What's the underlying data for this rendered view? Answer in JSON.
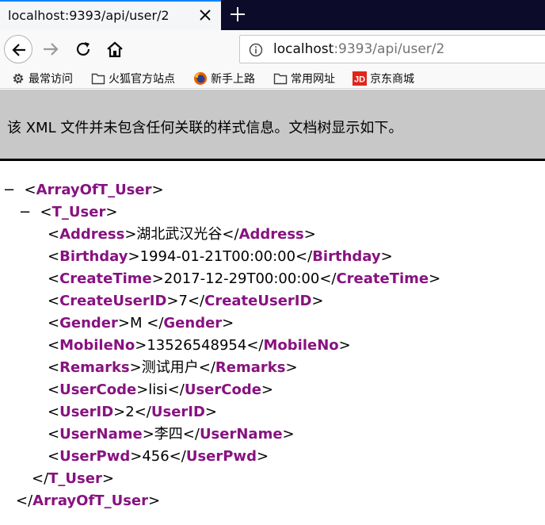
{
  "tab": {
    "title": "localhost:9393/api/user/2"
  },
  "url": {
    "host": "localhost",
    "rest": ":9393/api/user/2"
  },
  "bookmarks": [
    {
      "label": "最常访问",
      "icon": "gear-icon"
    },
    {
      "label": "火狐官方站点",
      "icon": "folder-icon"
    },
    {
      "label": "新手上路",
      "icon": "firefox-icon"
    },
    {
      "label": "常用网址",
      "icon": "folder-icon"
    },
    {
      "label": "京东商城",
      "icon": "jd-icon"
    }
  ],
  "banner": {
    "text": "该 XML 文件并未包含任何关联的样式信息。文档树显示如下。"
  },
  "xml": {
    "collapse_glyph": "−",
    "root": {
      "name": "ArrayOfT_User"
    },
    "item": {
      "name": "T_User"
    },
    "fields": [
      {
        "name": "Address",
        "value": "湖北武汉光谷"
      },
      {
        "name": "Birthday",
        "value": "1994-01-21T00:00:00"
      },
      {
        "name": "CreateTime",
        "value": "2017-12-29T00:00:00"
      },
      {
        "name": "CreateUserID",
        "value": "7"
      },
      {
        "name": "Gender",
        "value": "M "
      },
      {
        "name": "MobileNo",
        "value": "13526548954"
      },
      {
        "name": "Remarks",
        "value": "测试用户"
      },
      {
        "name": "UserCode",
        "value": "lisi"
      },
      {
        "name": "UserID",
        "value": "2"
      },
      {
        "name": "UserName",
        "value": "李四"
      },
      {
        "name": "UserPwd",
        "value": "456"
      }
    ]
  }
}
